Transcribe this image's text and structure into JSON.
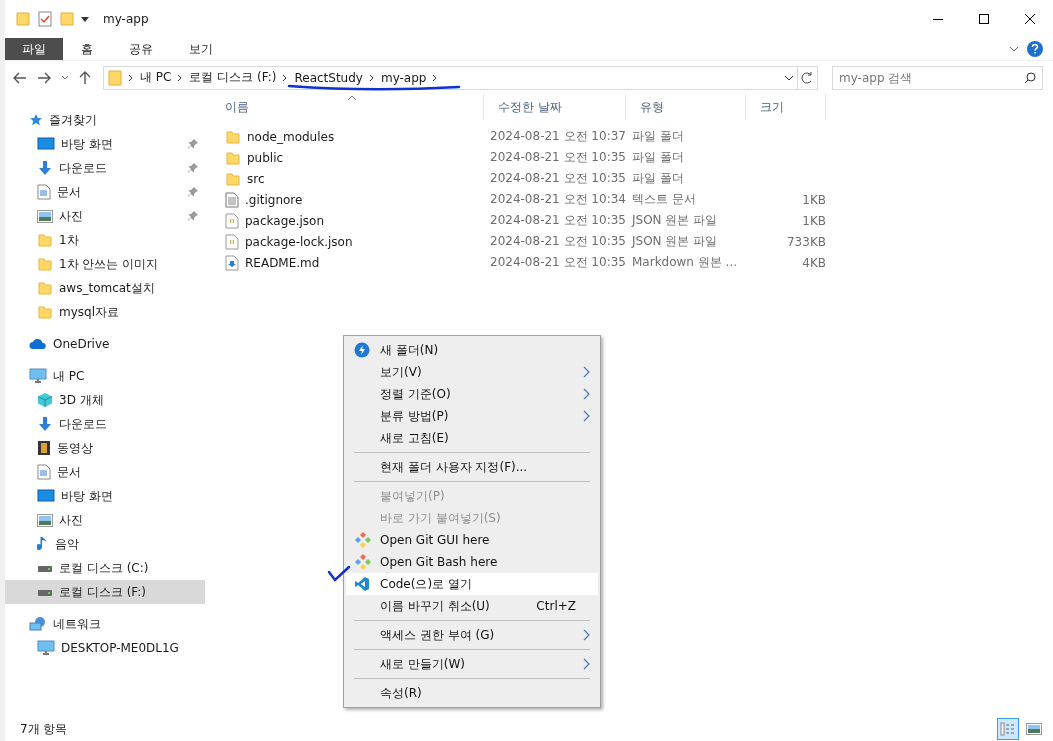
{
  "window": {
    "title": "my-app"
  },
  "ribbon_tabs": [
    {
      "label": "파일",
      "kind": "file"
    },
    {
      "label": "홈",
      "kind": "tab"
    },
    {
      "label": "공유",
      "kind": "tab"
    },
    {
      "label": "보기",
      "kind": "tab"
    }
  ],
  "address": {
    "crumbs": [
      "내 PC",
      "로컬 디스크 (F:)",
      "ReactStudy",
      "my-app"
    ]
  },
  "search": {
    "placeholder": "my-app 검색"
  },
  "sidebar": {
    "items": [
      {
        "label": "즐겨찾기",
        "kind": "star",
        "selected": false,
        "children": [
          {
            "label": "바탕 화면",
            "kind": "desktop",
            "pinned": true,
            "selected": false
          },
          {
            "label": "다운로드",
            "kind": "download",
            "pinned": true,
            "selected": false
          },
          {
            "label": "문서",
            "kind": "document",
            "pinned": true,
            "selected": false
          },
          {
            "label": "사진",
            "kind": "photo",
            "pinned": true,
            "selected": false
          },
          {
            "label": "1차",
            "kind": "folder",
            "pinned": false,
            "selected": false
          },
          {
            "label": "1차 안쓰는 이미지",
            "kind": "folder",
            "pinned": false,
            "selected": false
          },
          {
            "label": "aws_tomcat설치",
            "kind": "folder",
            "pinned": false,
            "selected": false
          },
          {
            "label": "mysql자료",
            "kind": "folder",
            "pinned": false,
            "selected": false
          }
        ]
      },
      {
        "label": "OneDrive",
        "kind": "cloud",
        "selected": false
      },
      {
        "label": "내 PC",
        "kind": "pc",
        "selected": false,
        "children": [
          {
            "label": "3D 개체",
            "kind": "cube",
            "selected": false
          },
          {
            "label": "다운로드",
            "kind": "download",
            "selected": false
          },
          {
            "label": "동영상",
            "kind": "video",
            "selected": false
          },
          {
            "label": "문서",
            "kind": "document",
            "selected": false
          },
          {
            "label": "바탕 화면",
            "kind": "desktop",
            "selected": false
          },
          {
            "label": "사진",
            "kind": "photo",
            "selected": false
          },
          {
            "label": "음악",
            "kind": "music",
            "selected": false
          },
          {
            "label": "로컬 디스크 (C:)",
            "kind": "drive",
            "selected": false
          },
          {
            "label": "로컬 디스크 (F:)",
            "kind": "drive",
            "selected": true
          }
        ]
      },
      {
        "label": "네트워크",
        "kind": "network",
        "selected": false,
        "children": [
          {
            "label": "DESKTOP-ME0DL1G",
            "kind": "pc",
            "selected": false
          }
        ]
      }
    ]
  },
  "table": {
    "columns": [
      {
        "label": "이름",
        "sorted": true
      },
      {
        "label": "수정한 날짜",
        "sorted": false
      },
      {
        "label": "유형",
        "sorted": false
      },
      {
        "label": "크기",
        "sorted": false
      }
    ],
    "rows": [
      {
        "kind": "folder",
        "name": "node_modules",
        "modified": "2024-08-21 오전 10:37",
        "type": "파일 폴더"
      },
      {
        "kind": "folder",
        "name": "public",
        "modified": "2024-08-21 오전 10:35",
        "type": "파일 폴더"
      },
      {
        "kind": "folder",
        "name": "src",
        "modified": "2024-08-21 오전 10:35",
        "type": "파일 폴더"
      },
      {
        "kind": "text",
        "name": ".gitignore",
        "modified": "2024-08-21 오전 10:34",
        "type": "텍스트 문서",
        "size": "1KB"
      },
      {
        "kind": "json",
        "name": "package.json",
        "modified": "2024-08-21 오전 10:35",
        "type": "JSON 원본 파일",
        "size": "1KB"
      },
      {
        "kind": "json",
        "name": "package-lock.json",
        "modified": "2024-08-21 오전 10:35",
        "type": "JSON 원본 파일",
        "size": "733KB"
      },
      {
        "kind": "markdown",
        "name": "README.md",
        "modified": "2024-08-21 오전 10:35",
        "type": "Markdown 원본 ...",
        "size": "4KB"
      }
    ]
  },
  "context_menu": {
    "items": [
      {
        "kind": "bolt",
        "label": "새 폴더(N)",
        "selected": false,
        "disabled": false,
        "submenu": false
      },
      {
        "kind": "item",
        "label": "보기(V)",
        "selected": false,
        "disabled": false,
        "submenu": true
      },
      {
        "kind": "item",
        "label": "정렬 기준(O)",
        "selected": false,
        "disabled": false,
        "submenu": true
      },
      {
        "kind": "item",
        "label": "분류 방법(P)",
        "selected": false,
        "disabled": false,
        "submenu": true
      },
      {
        "kind": "item",
        "label": "새로 고침(E)",
        "selected": false,
        "disabled": false,
        "submenu": false
      },
      {
        "kind": "separator"
      },
      {
        "kind": "item",
        "label": "현재 폴더 사용자 지정(F)...",
        "selected": false,
        "disabled": false,
        "submenu": false
      },
      {
        "kind": "separator"
      },
      {
        "kind": "item",
        "label": "붙여넣기(P)",
        "selected": false,
        "disabled": true,
        "submenu": false
      },
      {
        "kind": "item",
        "label": "바로 가기 붙여넣기(S)",
        "selected": false,
        "disabled": true,
        "submenu": false
      },
      {
        "kind": "git",
        "label": "Open Git GUI here",
        "selected": false,
        "disabled": false,
        "submenu": false
      },
      {
        "kind": "git",
        "label": "Open Git Bash here",
        "selected": false,
        "disabled": false,
        "submenu": false
      },
      {
        "kind": "code",
        "label": "Code(으)로 열기",
        "selected": true,
        "disabled": false,
        "submenu": false
      },
      {
        "kind": "item",
        "label": "이름 바꾸기 취소(U)",
        "shortcut": "Ctrl+Z",
        "selected": false,
        "disabled": false,
        "submenu": false
      },
      {
        "kind": "separator"
      },
      {
        "kind": "item",
        "label": "액세스 권한 부여 (G)",
        "selected": false,
        "disabled": false,
        "submenu": true
      },
      {
        "kind": "separator"
      },
      {
        "kind": "item",
        "label": "새로 만들기(W)",
        "selected": false,
        "disabled": false,
        "submenu": true
      },
      {
        "kind": "separator"
      },
      {
        "kind": "item",
        "label": "속성(R)",
        "selected": false,
        "disabled": false,
        "submenu": false
      }
    ]
  },
  "status_bar": {
    "item_count": "7개 항목"
  }
}
